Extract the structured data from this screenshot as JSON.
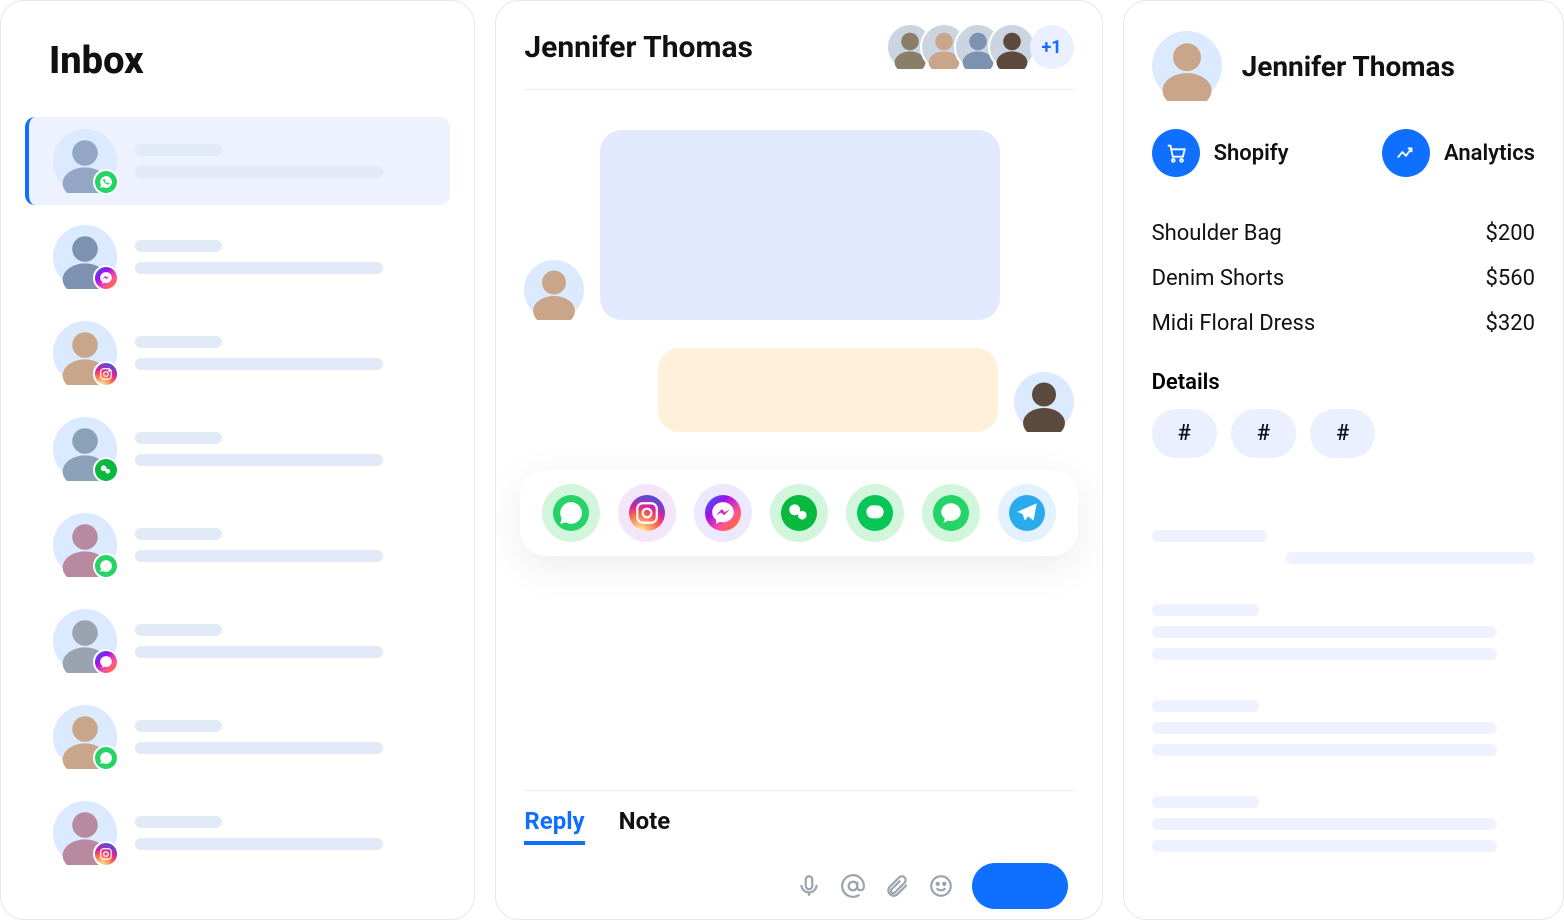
{
  "inbox": {
    "title": "Inbox",
    "items": [
      {
        "channel": "whatsapp"
      },
      {
        "channel": "messenger"
      },
      {
        "channel": "instagram"
      },
      {
        "channel": "wechat"
      },
      {
        "channel": "whatsapp"
      },
      {
        "channel": "messenger"
      },
      {
        "channel": "whatsapp"
      },
      {
        "channel": "instagram"
      }
    ]
  },
  "chat": {
    "title": "Jennifer Thomas",
    "participants_more": "+1",
    "channels": [
      "whatsapp",
      "instagram",
      "messenger",
      "wechat",
      "line",
      "sms",
      "telegram"
    ],
    "compose": {
      "tabs": {
        "reply": "Reply",
        "note": "Note"
      }
    }
  },
  "side": {
    "name": "Jennifer Thomas",
    "actions": {
      "shopify": "Shopify",
      "analytics": "Analytics"
    },
    "products": [
      {
        "name": "Shoulder Bag",
        "price": "$200"
      },
      {
        "name": "Denim Shorts",
        "price": "$560"
      },
      {
        "name": "Midi Floral Dress",
        "price": "$320"
      }
    ],
    "details_label": "Details",
    "tags": [
      "#",
      "#",
      "#"
    ]
  }
}
